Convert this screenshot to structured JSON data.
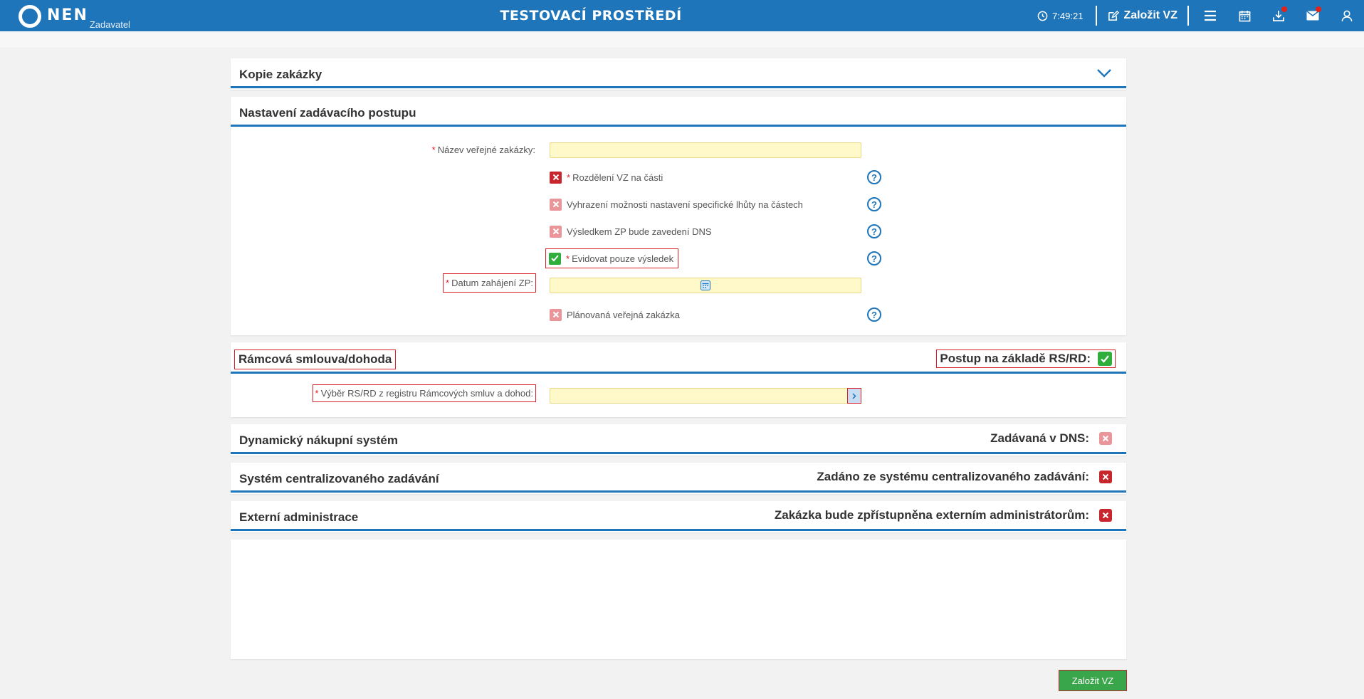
{
  "header": {
    "logo_text": "NEN",
    "logo_sub": "Zadavatel",
    "env_title": "TESTOVACÍ PROSTŘEDÍ",
    "clock": "7:49:21",
    "create_label": "Založit VZ"
  },
  "sections": {
    "kopie": {
      "title": "Kopie zakázky"
    },
    "nastaveni": {
      "title": "Nastavení zadávacího postupu",
      "name_label": "Název veřejné zakázky",
      "split_label": "Rozdělení VZ na části",
      "reserve_label": "Vyhrazení možnosti nastavení specifické lhůty na částech",
      "dns_label": "Výsledkem ZP bude zavedení DNS",
      "result_label": "Evidovat pouze výsledek",
      "date_label": "Datum zahájení ZP",
      "planned_label": "Plánovaná veřejná zakázka"
    },
    "ramcova": {
      "title": "Rámcová smlouva/dohoda",
      "right_label": "Postup na základě RS/RD:",
      "select_label": "Výběr RS/RD z registru Rámcových smluv a dohod"
    },
    "dns": {
      "title": "Dynamický nákupní systém",
      "right_label": "Zadávaná v DNS:"
    },
    "centralized": {
      "title": "Systém centralizovaného zadávání",
      "right_label": "Zadáno ze systému centralizovaného zadávání:"
    },
    "external": {
      "title": "Externí administrace",
      "right_label": "Zakázka bude zpřístupněna externím administrátorům:"
    }
  },
  "colon": ":",
  "required_mark": "*",
  "help_glyph": "?",
  "submit_label": "Založit VZ",
  "colors": {
    "brand": "#1f75b9",
    "input_bg": "#fff8c9",
    "check_on": "#2fae3c",
    "check_off": "#c9252c",
    "check_disabled": "#e9959a",
    "submit": "#3aa64c"
  }
}
